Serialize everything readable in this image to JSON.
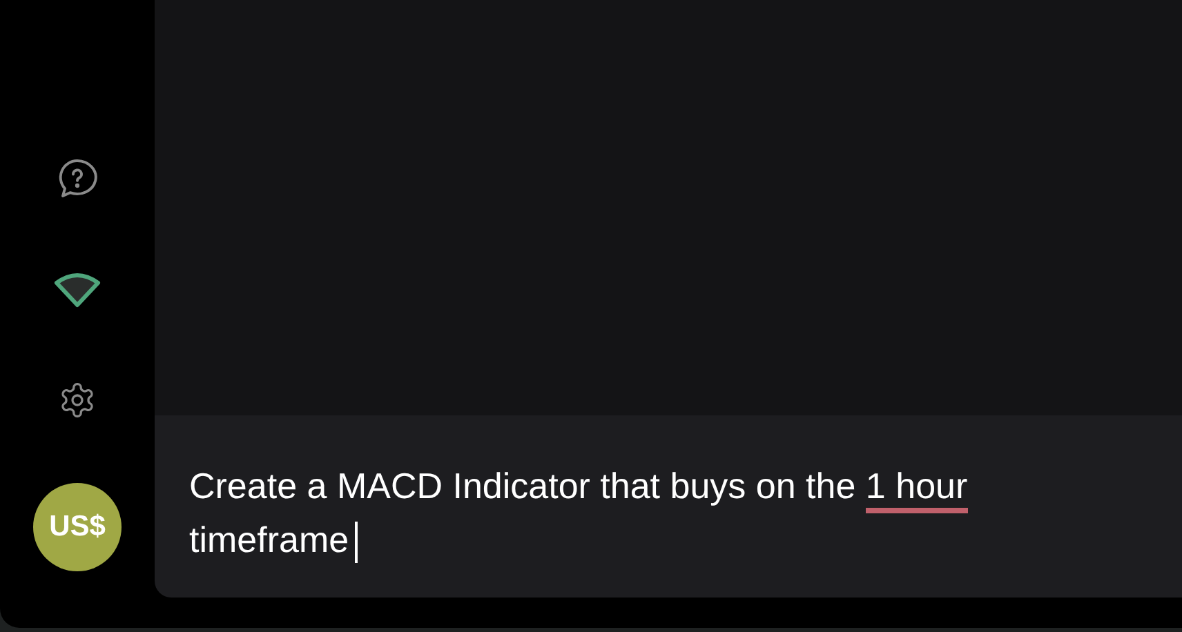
{
  "sidebar": {
    "items": [
      {
        "kind": "help",
        "selected": false
      },
      {
        "kind": "wedge",
        "selected": true
      },
      {
        "kind": "settings",
        "selected": false
      }
    ],
    "avatar": "US$"
  },
  "prompt": {
    "segments": [
      {
        "text": "Create a MACD Indicator that buys on the ",
        "flagged": false
      },
      {
        "text": "1 hour",
        "flagged": true
      },
      {
        "text": " timeframe",
        "flagged": false
      }
    ],
    "cursor": true
  }
}
